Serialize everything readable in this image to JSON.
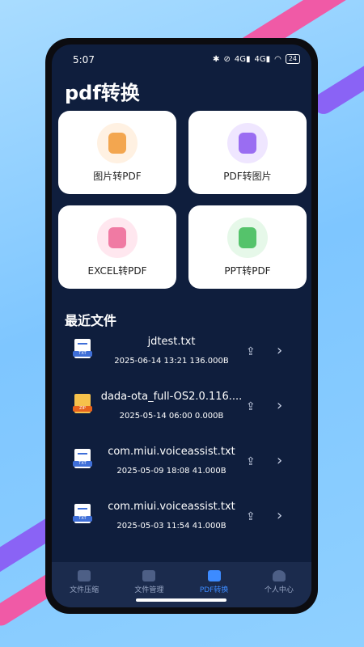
{
  "status": {
    "time": "5:07",
    "battery": "24",
    "icons": [
      "bluetooth-icon",
      "mute-icon",
      "4g-signal-icon",
      "4g-signal-icon",
      "wifi-icon"
    ]
  },
  "page_title": "pdf转换",
  "cards": [
    {
      "label": "图片转PDF",
      "icon": "image-to-pdf-icon",
      "color": "#f3a64f",
      "bg": "#fff1e2"
    },
    {
      "label": "PDF转图片",
      "icon": "pdf-to-image-icon",
      "color": "#9a6df2",
      "bg": "#efe6ff"
    },
    {
      "label": "EXCEL转PDF",
      "icon": "excel-to-pdf-icon",
      "color": "#f07aa3",
      "bg": "#ffe7ef"
    },
    {
      "label": "PPT转PDF",
      "icon": "ppt-to-pdf-icon",
      "color": "#55c36b",
      "bg": "#e6f8e9"
    }
  ],
  "section_title": "最近文件",
  "files": [
    {
      "name": "jdtest.txt",
      "meta": "2025-06-14 13:21 136.000B",
      "type": "TXT"
    },
    {
      "name": "dada-ota_full-OS2.0.116....",
      "meta": "2025-05-14 06:00 0.000B",
      "type": "ZIP"
    },
    {
      "name": "com.miui.voiceassist.txt",
      "meta": "2025-05-09 18:08 41.000B",
      "type": "TXT"
    },
    {
      "name": "com.miui.voiceassist.txt",
      "meta": "2025-05-03 11:54 41.000B",
      "type": "TXT"
    }
  ],
  "tabs": [
    {
      "label": "文件压缩",
      "icon": "home-icon",
      "active": false
    },
    {
      "label": "文件管理",
      "icon": "folder-icon",
      "active": false
    },
    {
      "label": "PDF转换",
      "icon": "document-icon",
      "active": true
    },
    {
      "label": "个人中心",
      "icon": "person-icon",
      "active": false
    }
  ],
  "colors": {
    "screen_bg": "#0f1e3d",
    "accent": "#3d8bff",
    "tabbar_bg": "#1b2b4d"
  }
}
